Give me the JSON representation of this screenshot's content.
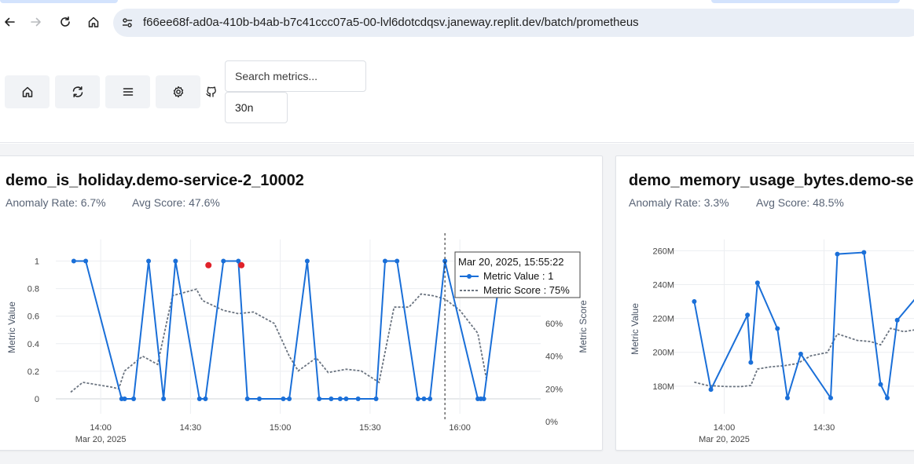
{
  "browser": {
    "url": "f66ee68f-ad0a-410b-b4ab-b7c41ccc07a5-00-lvl6dotcdqsv.janeway.replit.dev/batch/prometheus"
  },
  "toolbar": {
    "search_placeholder": "Search metrics...",
    "time_range_value": "30n"
  },
  "cards": [
    {
      "title": "demo_is_holiday.demo-service-2_10002",
      "anomaly_rate": "Anomaly Rate: 6.7%",
      "avg_score": "Avg Score: 47.6%"
    },
    {
      "title": "demo_memory_usage_bytes.demo-service-2_10002",
      "anomaly_rate": "Anomaly Rate: 3.3%",
      "avg_score": "Avg Score: 48.5%"
    }
  ],
  "tooltip": {
    "header": "Mar 20, 2025, 15:55:22",
    "value_line": "Metric Value : 1",
    "score_line": "Metric Score : 75%"
  },
  "colors": {
    "value_line": "#1a6fd8",
    "score_line": "#6b7480",
    "anomaly": "#e0222a"
  },
  "chart_data": [
    {
      "type": "line",
      "ylabel": "Metric Value",
      "y2label": "Metric Score",
      "x_tick_labels": [
        "14:00",
        "14:30",
        "15:00",
        "15:30",
        "16:00"
      ],
      "x_tick_sub": "Mar 20, 2025",
      "y_ticks": [
        "0",
        "0.2",
        "0.4",
        "0.6",
        "0.8",
        "1"
      ],
      "y2_ticks": [
        "0%",
        "20%",
        "40%",
        "60%"
      ],
      "xlim": [
        "13:45",
        "16:27"
      ],
      "ylim": [
        -0.08,
        1.1
      ],
      "y2lim": [
        0,
        1.0
      ],
      "series": [
        {
          "name": "Metric Value",
          "x": [
            "13:51",
            "13:55",
            "14:07",
            "14:08",
            "14:11",
            "14:16",
            "14:21",
            "14:25",
            "14:33",
            "14:35",
            "14:41",
            "14:46",
            "14:49",
            "14:53",
            "15:01",
            "15:03",
            "15:09",
            "15:13",
            "15:17",
            "15:20",
            "15:22",
            "15:26",
            "15:32",
            "15:35",
            "15:39",
            "15:46",
            "15:48",
            "15:50",
            "15:55",
            "16:06",
            "16:07",
            "16:08",
            "16:14"
          ],
          "values": [
            1,
            1,
            0,
            0,
            0,
            1,
            0,
            1,
            0,
            0,
            1,
            1,
            0,
            0,
            0,
            0,
            1,
            0,
            0,
            0,
            0,
            0,
            0,
            1,
            1,
            0,
            0,
            0,
            1,
            0,
            0,
            0,
            1
          ]
        },
        {
          "name": "Metric Score",
          "x": [
            "13:50",
            "13:54",
            "14:04",
            "14:06",
            "14:08",
            "14:14",
            "14:19",
            "14:24",
            "14:32",
            "14:34",
            "14:41",
            "14:46",
            "14:51",
            "14:58",
            "15:03",
            "15:06",
            "15:12",
            "15:16",
            "15:22",
            "15:27",
            "15:33",
            "15:38",
            "15:43",
            "15:47",
            "15:51",
            "15:55",
            "16:00",
            "16:06",
            "16:09"
          ],
          "values": [
            0.18,
            0.24,
            0.21,
            0.2,
            0.31,
            0.4,
            0.35,
            0.77,
            0.81,
            0.74,
            0.68,
            0.66,
            0.67,
            0.6,
            0.4,
            0.31,
            0.39,
            0.3,
            0.32,
            0.31,
            0.24,
            0.7,
            0.7,
            0.78,
            0.77,
            0.75,
            0.68,
            0.54,
            0.25
          ]
        }
      ],
      "anomalies": [
        {
          "x": "14:36",
          "y": 0.97
        },
        {
          "x": "14:47",
          "y": 0.97
        }
      ],
      "hover_x": "15:55"
    },
    {
      "type": "line",
      "ylabel": "Metric Value",
      "x_tick_labels": [
        "14:00",
        "14:30"
      ],
      "x_tick_sub": "Mar 20, 2025",
      "y_ticks": [
        "180M",
        "200M",
        "220M",
        "240M",
        "260M"
      ],
      "xlim": [
        "13:45",
        "15:02"
      ],
      "ylim": [
        166,
        262
      ],
      "score_ylim": [
        0,
        1.0
      ],
      "series": [
        {
          "name": "Metric Value",
          "x": [
            "13:51",
            "13:56",
            "14:07",
            "14:08",
            "14:10",
            "14:16",
            "14:19",
            "14:23",
            "14:32",
            "14:34",
            "14:42",
            "14:47",
            "14:49",
            "14:52",
            "15:01"
          ],
          "values": [
            230,
            178,
            222,
            194,
            241,
            214,
            173,
            199,
            173,
            258,
            259,
            181,
            173,
            219,
            240
          ]
        },
        {
          "name": "Metric Score",
          "x": [
            "13:51",
            "13:55",
            "14:01",
            "14:05",
            "14:08",
            "14:10",
            "14:14",
            "14:18",
            "14:22",
            "14:26",
            "14:31",
            "14:34",
            "14:40",
            "14:44",
            "14:47",
            "14:50",
            "14:54",
            "14:58",
            "15:02"
          ],
          "values": [
            0.18,
            0.15,
            0.14,
            0.14,
            0.15,
            0.3,
            0.32,
            0.33,
            0.35,
            0.42,
            0.45,
            0.62,
            0.56,
            0.55,
            0.52,
            0.67,
            0.64,
            0.66,
            0.72
          ]
        }
      ]
    }
  ]
}
